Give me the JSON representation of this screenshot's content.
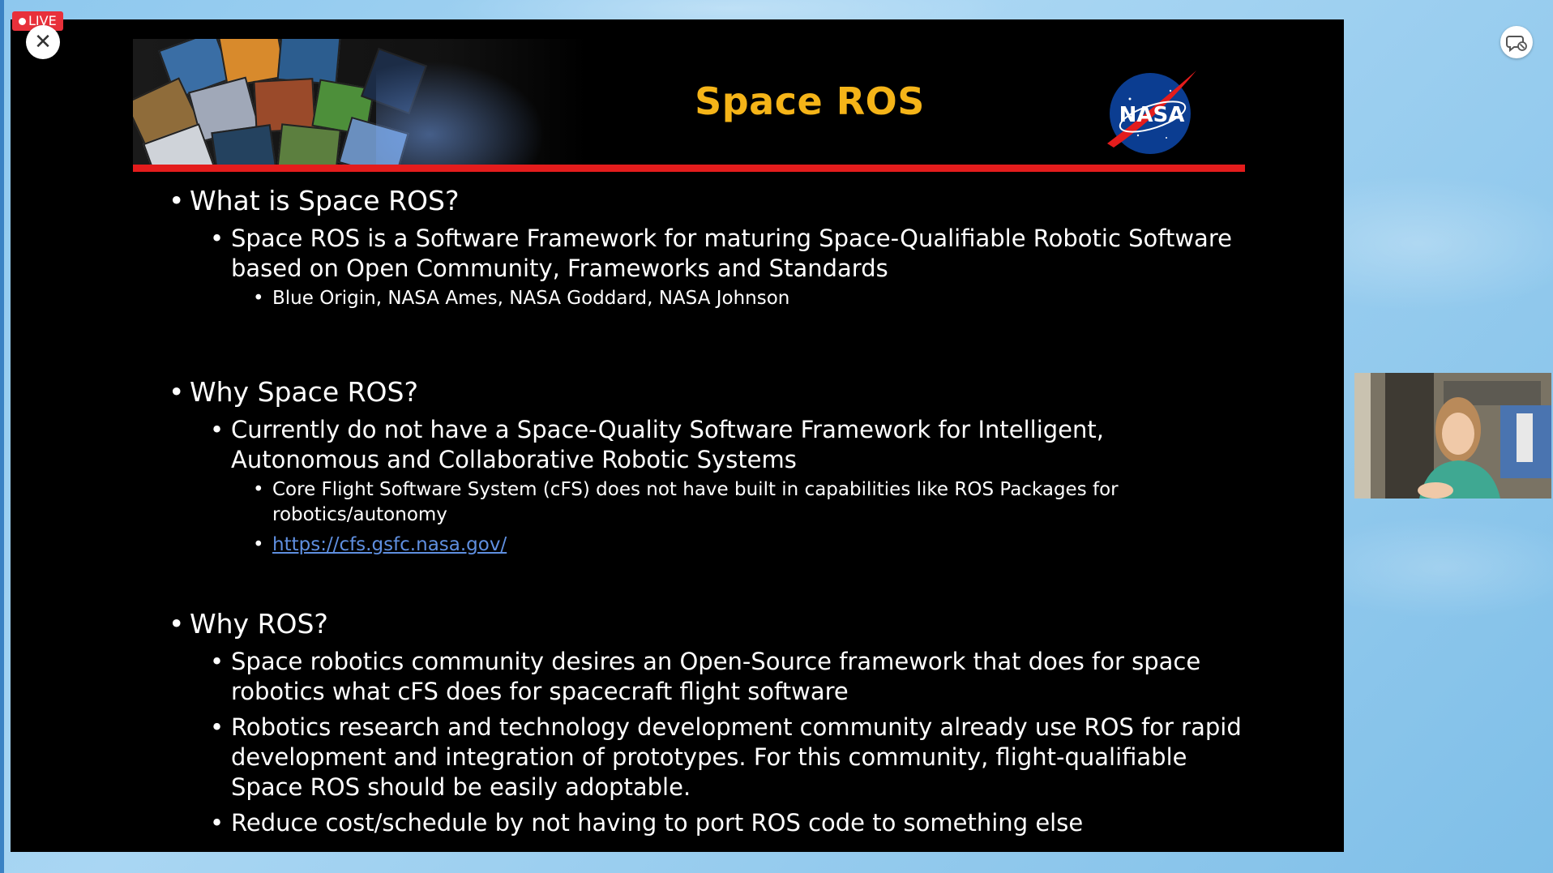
{
  "stream": {
    "live_label": "LIVE",
    "close_label": "✕"
  },
  "slide": {
    "title": "Space ROS",
    "logo_text": "NASA",
    "sections": [
      {
        "heading": "What is Space ROS?",
        "points": [
          {
            "text_lines": [
              "Space ROS is a Software Framework for maturing Space-Qualifiable Robotic Software",
              "based on Open Community, Frameworks and Standards"
            ],
            "sub": [
              {
                "lines": [
                  "Blue Origin, NASA Ames, NASA Goddard, NASA Johnson"
                ]
              }
            ]
          }
        ]
      },
      {
        "heading": "Why Space ROS?",
        "points": [
          {
            "text_lines": [
              "Currently do not have a Space-Quality Software Framework for Intelligent,",
              "Autonomous and Collaborative Robotic Systems"
            ],
            "sub": [
              {
                "lines": [
                  "Core Flight Software System (cFS) does not have built in capabilities like ROS Packages for",
                  "robotics/autonomy"
                ]
              },
              {
                "lines": [
                  "https://cfs.gsfc.nasa.gov/"
                ]
              }
            ]
          }
        ]
      },
      {
        "heading": "Why ROS?",
        "points": [
          {
            "text_lines": [
              "Space robotics community desires an Open-Source framework that does for space",
              "robotics what cFS does for spacecraft flight software"
            ]
          },
          {
            "text_lines": [
              "Robotics research and technology development community already use ROS for rapid",
              "development and integration of prototypes. For this community, flight-qualifiable",
              "Space ROS should be easily adoptable."
            ]
          },
          {
            "text_lines": [
              "Reduce cost/schedule by not having to port ROS code to something else"
            ]
          }
        ]
      }
    ]
  },
  "icons": {
    "close": "close-icon",
    "chat": "chat-bubble-icon",
    "bullet": "•"
  },
  "colors": {
    "title": "#f5b418",
    "red_bar": "#e41c1c",
    "live": "#e8303a",
    "link": "#5f8fe0"
  }
}
